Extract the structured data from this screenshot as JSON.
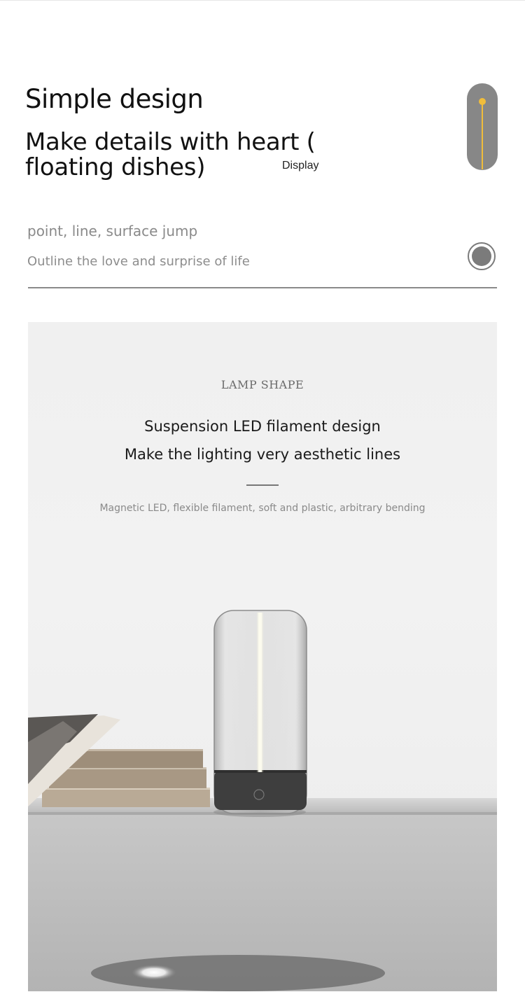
{
  "header": {
    "title": "Simple design",
    "subtitle": "Make details with heart ( floating dishes)",
    "display_label": "Display"
  },
  "features": {
    "tagline": "point, line, surface jump",
    "tagline_sub": "Outline the love and surprise of life"
  },
  "product": {
    "heading": "LAMP SHAPE",
    "title_line1": "Suspension LED filament design",
    "title_line2": "Make the lighting very aesthetic lines",
    "description": "Magnetic LED, flexible filament, soft and plastic, arbitrary bending"
  },
  "colors": {
    "accent": "#f0bd3b",
    "control_gray": "#878787",
    "panel_bg": "#f0f0f0"
  },
  "icons": {
    "slider": "vertical-slider-icon",
    "radio": "radio-button-icon"
  }
}
